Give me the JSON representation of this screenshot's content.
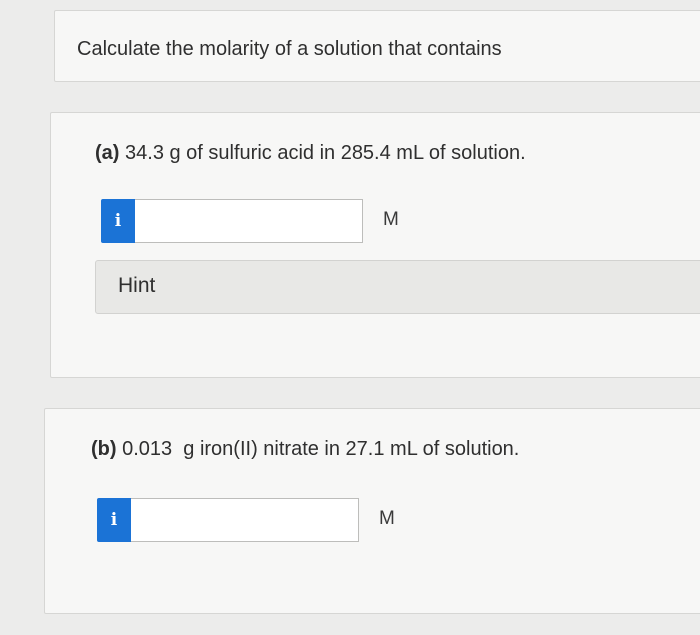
{
  "question": {
    "prompt": "Calculate the molarity of a solution that contains"
  },
  "parts": [
    {
      "label": "(a)",
      "text": "34.3 g of sulfuric acid in 285.4 mL of solution.",
      "info_icon": "i",
      "input_value": "",
      "unit": "M",
      "hint_label": "Hint"
    },
    {
      "label": "(b)",
      "text": "0.013  g iron(II) nitrate in 27.1 mL of solution.",
      "info_icon": "i",
      "input_value": "",
      "unit": "M"
    }
  ],
  "colors": {
    "info_button": "#1b73d6",
    "page_background": "#ececeb",
    "card_background": "#f7f7f6"
  }
}
